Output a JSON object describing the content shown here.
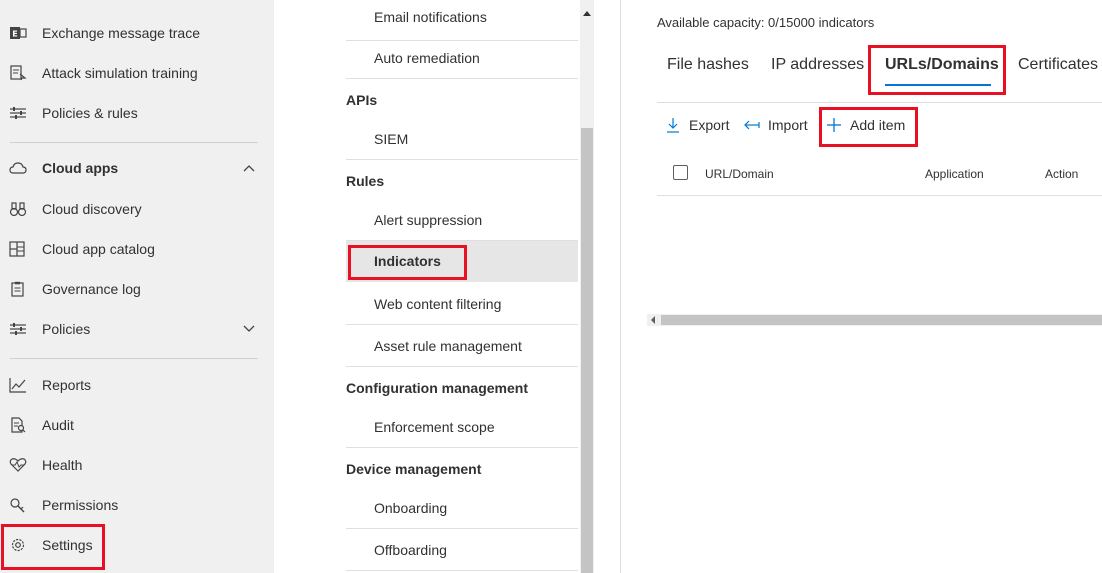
{
  "left_nav": {
    "items": [
      {
        "label": "Exchange message trace",
        "icon": "exchange-icon"
      },
      {
        "label": "Attack simulation training",
        "icon": "simulation-icon"
      },
      {
        "label": "Policies & rules",
        "icon": "sliders-icon"
      },
      {
        "label": "Cloud apps",
        "icon": "cloud-icon"
      },
      {
        "label": "Cloud discovery",
        "icon": "binoculars-icon"
      },
      {
        "label": "Cloud app catalog",
        "icon": "catalog-icon"
      },
      {
        "label": "Governance log",
        "icon": "clipboard-icon"
      },
      {
        "label": "Policies",
        "icon": "sliders-icon"
      },
      {
        "label": "Reports",
        "icon": "chart-line-icon"
      },
      {
        "label": "Audit",
        "icon": "document-search-icon"
      },
      {
        "label": "Health",
        "icon": "heart-pulse-icon"
      },
      {
        "label": "Permissions",
        "icon": "key-icon"
      },
      {
        "label": "Settings",
        "icon": "gear-icon"
      }
    ]
  },
  "settings_menu": {
    "items": [
      {
        "label": "Email notifications"
      },
      {
        "label": "Auto remediation"
      },
      {
        "label": "SIEM"
      },
      {
        "label": "Alert suppression"
      },
      {
        "label": "Indicators"
      },
      {
        "label": "Web content filtering"
      },
      {
        "label": "Asset rule management"
      },
      {
        "label": "Enforcement scope"
      },
      {
        "label": "Onboarding"
      },
      {
        "label": "Offboarding"
      }
    ],
    "headings": [
      "APIs",
      "Rules",
      "Configuration management",
      "Device management"
    ]
  },
  "content": {
    "capacity": "Available capacity: 0/15000 indicators",
    "tabs": [
      {
        "label": "File hashes"
      },
      {
        "label": "IP addresses"
      },
      {
        "label": "URLs/Domains"
      },
      {
        "label": "Certificates"
      }
    ],
    "active_tab": "URLs/Domains",
    "toolbar": {
      "export": "Export",
      "import": "Import",
      "add_item": "Add item"
    },
    "columns": [
      "URL/Domain",
      "Application",
      "Action"
    ]
  },
  "colors": {
    "highlight": "#e81123",
    "accent": "#0078d4",
    "nav_bg": "#f0f0f0"
  }
}
